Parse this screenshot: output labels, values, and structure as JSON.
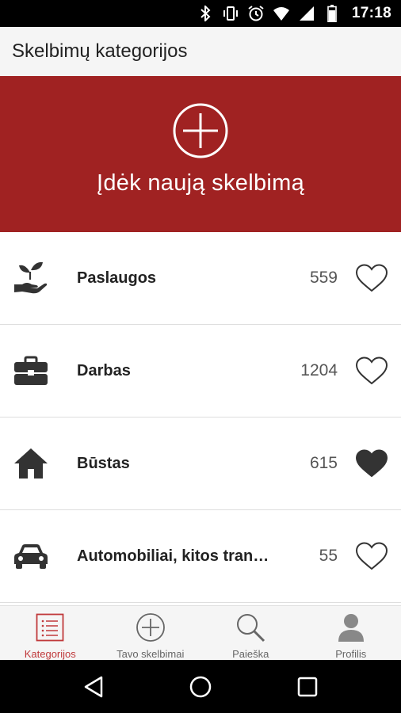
{
  "status_bar": {
    "time": "17:18",
    "icons": [
      "bluetooth-icon",
      "vibrate-icon",
      "alarm-icon",
      "wifi-icon",
      "signal-icon",
      "battery-icon"
    ]
  },
  "app_bar": {
    "title": "Skelbimų kategorijos"
  },
  "hero": {
    "label": "Įdėk naują skelbimą",
    "icon": "plus-circle-icon",
    "background": "#a02222"
  },
  "categories": [
    {
      "name": "Paslaugos",
      "count": "559",
      "icon": "hand-plant-icon",
      "favorite": false
    },
    {
      "name": "Darbas",
      "count": "1204",
      "icon": "briefcase-icon",
      "favorite": false
    },
    {
      "name": "Būstas",
      "count": "615",
      "icon": "house-icon",
      "favorite": true
    },
    {
      "name": "Automobiliai, kitos transporto priemonės",
      "count": "55",
      "icon": "car-icon",
      "favorite": false
    }
  ],
  "bottom_nav": {
    "items": [
      {
        "label": "Kategorijos",
        "icon": "list-icon",
        "active": true
      },
      {
        "label": "Tavo skelbimai",
        "icon": "plus-circle-icon",
        "active": false
      },
      {
        "label": "Paieška",
        "icon": "search-icon",
        "active": false
      },
      {
        "label": "Profilis",
        "icon": "person-icon",
        "active": false
      }
    ]
  },
  "colors": {
    "accent": "#a02222",
    "active_nav": "#c0393b",
    "icon_dark": "#333333"
  }
}
